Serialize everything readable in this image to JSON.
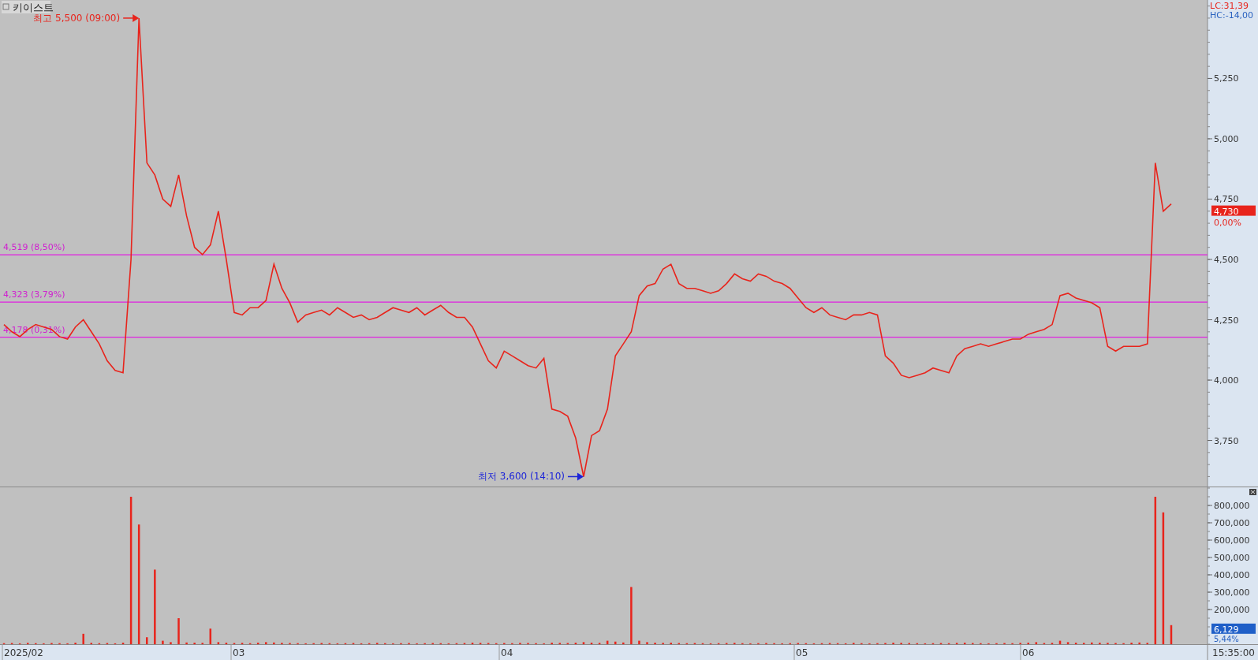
{
  "title": "키이스트",
  "indicators": [
    {
      "text": "LC:31,39",
      "color": "#e8241c"
    },
    {
      "text": "HC:-14,00",
      "color": "#2a62c0"
    }
  ],
  "price_panel": {
    "chart_data": {
      "type": "line",
      "ylim": [
        3559,
        5575
      ],
      "yticks": [
        {
          "value": 3750,
          "label": "3,750"
        },
        {
          "value": 4000,
          "label": "4,000"
        },
        {
          "value": 4250,
          "label": "4,250"
        },
        {
          "value": 4500,
          "label": "4,500"
        },
        {
          "value": 4750,
          "label": "4,750"
        },
        {
          "value": 5000,
          "label": "5,000"
        },
        {
          "value": 5250,
          "label": "5,250"
        }
      ],
      "series": [
        {
          "color": "#e8241c",
          "values": [
            4230,
            4200,
            4180,
            4210,
            4230,
            4220,
            4210,
            4180,
            4170,
            4220,
            4250,
            4200,
            4150,
            4080,
            4040,
            4030,
            4500,
            5500,
            4900,
            4850,
            4750,
            4720,
            4850,
            4680,
            4550,
            4520,
            4560,
            4700,
            4500,
            4280,
            4270,
            4300,
            4300,
            4330,
            4480,
            4380,
            4320,
            4240,
            4270,
            4280,
            4290,
            4270,
            4300,
            4280,
            4260,
            4270,
            4250,
            4260,
            4280,
            4300,
            4290,
            4280,
            4300,
            4270,
            4290,
            4310,
            4280,
            4260,
            4260,
            4220,
            4150,
            4080,
            4050,
            4120,
            4100,
            4080,
            4060,
            4050,
            4090,
            3880,
            3870,
            3850,
            3760,
            3600,
            3770,
            3790,
            3880,
            4100,
            4150,
            4200,
            4350,
            4390,
            4400,
            4460,
            4480,
            4400,
            4380,
            4380,
            4370,
            4360,
            4370,
            4400,
            4440,
            4420,
            4410,
            4440,
            4430,
            4410,
            4400,
            4380,
            4340,
            4300,
            4280,
            4300,
            4270,
            4260,
            4250,
            4270,
            4270,
            4280,
            4270,
            4100,
            4070,
            4020,
            4010,
            4020,
            4030,
            4050,
            4040,
            4030,
            4100,
            4130,
            4140,
            4150,
            4140,
            4150,
            4160,
            4170,
            4170,
            4190,
            4200,
            4210,
            4230,
            4350,
            4360,
            4340,
            4330,
            4320,
            4300,
            4140,
            4120,
            4140,
            4140,
            4140,
            4150,
            4900,
            4700,
            4730
          ]
        }
      ],
      "ref_lines": [
        {
          "axis": "y",
          "value": 4519,
          "label": "4,519 (8,50%)"
        },
        {
          "axis": "y",
          "value": 4323,
          "label": "4,323 (3,79%)"
        },
        {
          "axis": "y",
          "value": 4178,
          "label": "4,178 (0,31%)"
        }
      ],
      "annotations": [
        "최고 5,500 (09:00)",
        "최저 3,600 (14:10)",
        "4,730"
      ]
    }
  },
  "price_change": "0,00%",
  "volume_panel": {
    "chart_data": {
      "type": "bar",
      "ylim": [
        0,
        909000
      ],
      "yticks": [
        {
          "value": 200000,
          "label": "200,000"
        },
        {
          "value": 300000,
          "label": "300,000"
        },
        {
          "value": 400000,
          "label": "400,000"
        },
        {
          "value": 500000,
          "label": "500,000"
        },
        {
          "value": 600000,
          "label": "600,000"
        },
        {
          "value": 700000,
          "label": "700,000"
        },
        {
          "value": 800000,
          "label": "800,000"
        }
      ],
      "series": [
        {
          "color": "#e8241c",
          "values": [
            6000,
            7000,
            5000,
            8000,
            6000,
            5000,
            7000,
            6000,
            5000,
            9000,
            60000,
            8000,
            6000,
            7000,
            5000,
            9000,
            850000,
            690000,
            40000,
            430000,
            20000,
            12000,
            150000,
            10000,
            9000,
            8000,
            90000,
            12000,
            9000,
            7000,
            8000,
            6000,
            9000,
            12000,
            10000,
            8000,
            7000,
            6000,
            5000,
            6000,
            7000,
            6000,
            5000,
            6000,
            7000,
            5000,
            6000,
            8000,
            6000,
            5000,
            6000,
            7000,
            5000,
            6000,
            7000,
            6000,
            5000,
            6000,
            7000,
            9000,
            8000,
            7000,
            6000,
            7000,
            6000,
            8000,
            7000,
            6000,
            5000,
            9000,
            8000,
            7000,
            9000,
            12000,
            9000,
            8000,
            20000,
            15000,
            10000,
            330000,
            20000,
            12000,
            9000,
            8000,
            9000,
            7000,
            6000,
            7000,
            6000,
            5000,
            6000,
            7000,
            8000,
            6000,
            5000,
            6000,
            7000,
            6000,
            5000,
            6000,
            7000,
            6000,
            5000,
            6000,
            7000,
            6000,
            5000,
            8000,
            6000,
            5000,
            6000,
            7000,
            9000,
            8000,
            7000,
            6000,
            5000,
            6000,
            7000,
            6000,
            8000,
            9000,
            7000,
            6000,
            5000,
            6000,
            7000,
            6000,
            8000,
            9000,
            12000,
            7000,
            8000,
            20000,
            12000,
            9000,
            8000,
            10000,
            9000,
            8000,
            7000,
            6000,
            9000,
            10000,
            8000,
            850000,
            760000,
            110000
          ]
        }
      ],
      "annotations": [
        "6,129"
      ]
    }
  },
  "date_axis": [
    "2025/02",
    "03",
    "04",
    "05",
    "06"
  ],
  "volume_change": "5,44%",
  "time_label": "15:35:00"
}
